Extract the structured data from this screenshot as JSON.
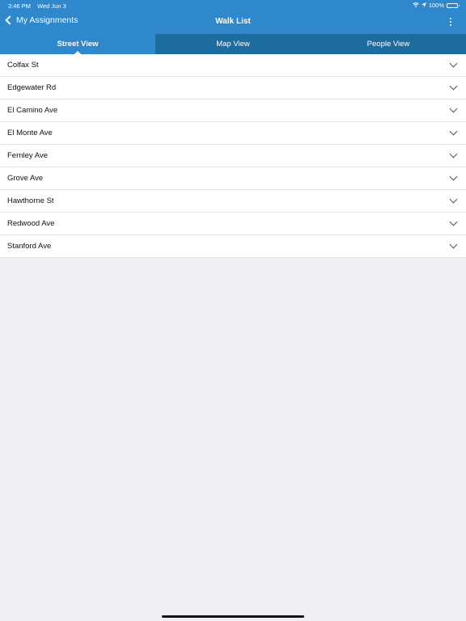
{
  "status_bar": {
    "time": "3:46 PM",
    "date": "Wed Jun 3",
    "battery": "100%",
    "battery_level": 1.0
  },
  "nav": {
    "back_label": "My Assignments",
    "title": "Walk List"
  },
  "tabs": [
    {
      "label": "Street View",
      "active": true
    },
    {
      "label": "Map View",
      "active": false
    },
    {
      "label": "People View",
      "active": false
    }
  ],
  "streets": [
    {
      "name": "Colfax St"
    },
    {
      "name": "Edgewater Rd"
    },
    {
      "name": "El Camino Ave"
    },
    {
      "name": "El Monte Ave"
    },
    {
      "name": "Fernley Ave"
    },
    {
      "name": "Grove Ave"
    },
    {
      "name": "Hawthorne St"
    },
    {
      "name": "Redwood Ave"
    },
    {
      "name": "Stanford Ave"
    }
  ],
  "colors": {
    "header": "#2f87cc",
    "tab_bar": "#1d6c9f",
    "background": "#efeef3"
  },
  "icons": {
    "back": "chevron-left-icon",
    "more": "more-vertical-icon",
    "expand": "chevron-down-icon",
    "wifi": "wifi-icon",
    "location": "location-arrow-icon",
    "battery": "battery-icon"
  }
}
